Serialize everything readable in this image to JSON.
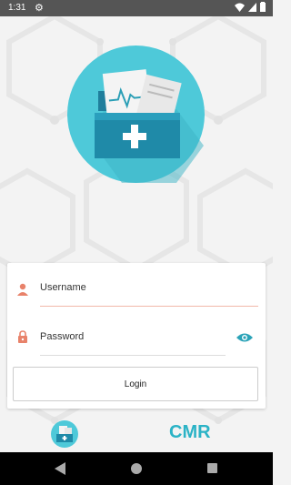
{
  "status_bar": {
    "time": "1:31",
    "icons": [
      "gear-icon",
      "wifi-icon",
      "signal-icon",
      "battery-icon"
    ]
  },
  "login_form": {
    "username_placeholder": "Username",
    "password_placeholder": "Password",
    "login_label": "Login"
  },
  "footer": {
    "brand": "CMR"
  },
  "colors": {
    "accent": "#2bb3c6",
    "logo_circle": "#4ec9d9",
    "field_icon": "#e8826a",
    "eye_icon": "#2ba3b8"
  }
}
